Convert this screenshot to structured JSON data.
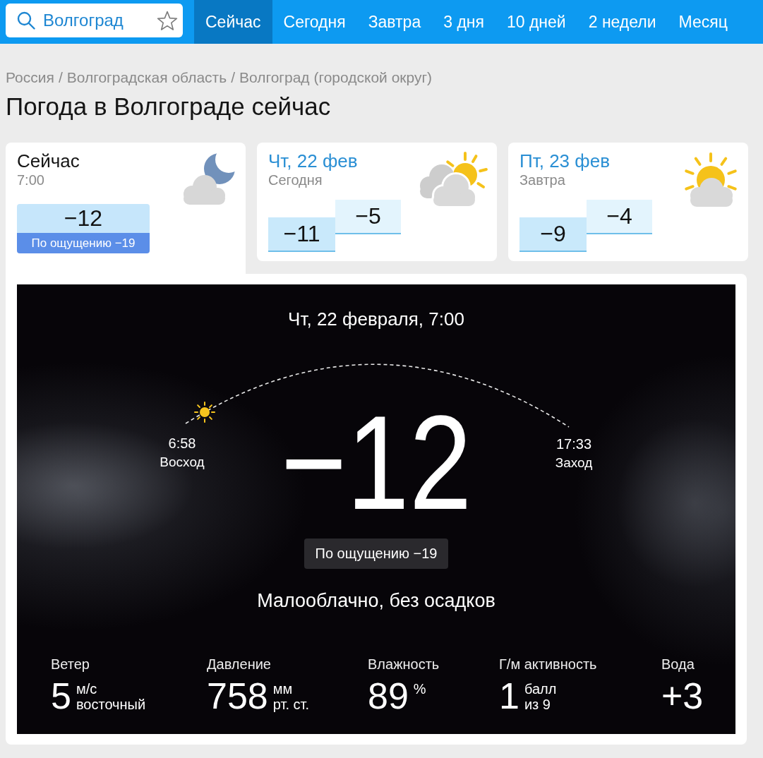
{
  "search": {
    "value": "Волгоград"
  },
  "tabs": [
    {
      "label": "Сейчас",
      "selected": true
    },
    {
      "label": "Сегодня",
      "selected": false
    },
    {
      "label": "Завтра",
      "selected": false
    },
    {
      "label": "3 дня",
      "selected": false
    },
    {
      "label": "10 дней",
      "selected": false
    },
    {
      "label": "2 недели",
      "selected": false
    },
    {
      "label": "Месяц",
      "selected": false
    }
  ],
  "breadcrumbs": [
    {
      "label": "Россия",
      "separator": "/"
    },
    {
      "label": "Волгоградская область",
      "separator": "/"
    },
    {
      "label": "Волгоград (городской округ)"
    }
  ],
  "title": "Погода в Волгограде сейчас",
  "forecast_cards": [
    {
      "kind": "now",
      "selected": true,
      "title": "Сейчас",
      "subtitle": "7:00",
      "temp": "−12",
      "feels_like": "По ощущению −19"
    },
    {
      "kind": "day",
      "selected": false,
      "title": "Чт, 22 фев",
      "subtitle": "Сегодня",
      "temps": [
        {
          "kind": "low",
          "value": "−11"
        },
        {
          "kind": "high",
          "value": "−5"
        }
      ]
    },
    {
      "kind": "day",
      "selected": false,
      "title": "Пт, 23 фев",
      "subtitle": "Завтра",
      "temps": [
        {
          "kind": "low",
          "value": "−9"
        },
        {
          "kind": "high",
          "value": "−4"
        }
      ]
    }
  ],
  "current": {
    "datetime": "Чт, 22 февраля, 7:00",
    "sunrise": {
      "time": "6:58",
      "label": "Восход"
    },
    "sunset": {
      "time": "17:33",
      "label": "Заход"
    },
    "temp": "−12",
    "feels_like": "По ощущению −19",
    "condition": "Малооблачно, без осадков",
    "stats": [
      {
        "label": "Ветер",
        "value": "5",
        "units": [
          "м/с",
          "восточный"
        ]
      },
      {
        "label": "Давление",
        "value": "758",
        "units": [
          "мм",
          "рт. ст."
        ]
      },
      {
        "label": "Влажность",
        "value": "89",
        "units": [
          "%"
        ]
      },
      {
        "label": "Г/м активность",
        "value": "1",
        "units": [
          "балл",
          "из 9"
        ]
      },
      {
        "label": "Вода",
        "value": "+3"
      }
    ]
  }
}
